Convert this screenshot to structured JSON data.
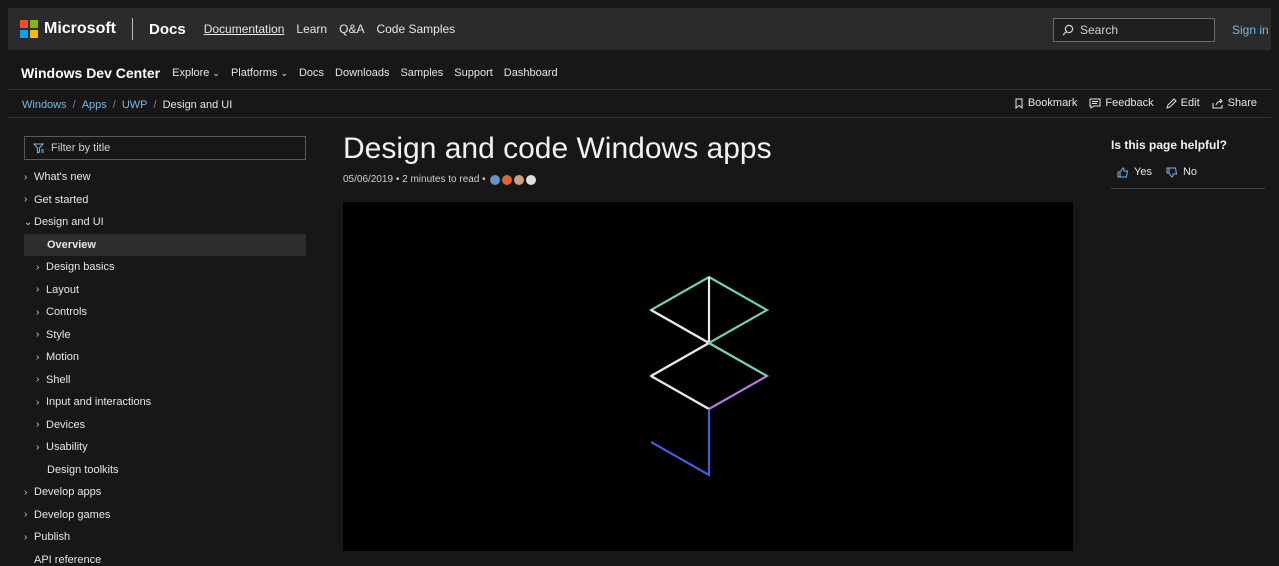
{
  "header": {
    "brand": "Microsoft",
    "brand_colors": [
      "#f25022",
      "#7fba00",
      "#00a4ef",
      "#ffb900"
    ],
    "docs": "Docs",
    "nav": [
      "Documentation",
      "Learn",
      "Q&A",
      "Code Samples"
    ],
    "search_placeholder": "Search",
    "sign_in": "Sign in"
  },
  "devcenter": {
    "title": "Windows Dev Center",
    "nav": [
      "Explore",
      "Platforms",
      "Docs",
      "Downloads",
      "Samples",
      "Support",
      "Dashboard"
    ]
  },
  "breadcrumb": {
    "items": [
      "Windows",
      "Apps",
      "UWP"
    ],
    "current": "Design and UI"
  },
  "actions": {
    "bookmark": "Bookmark",
    "feedback": "Feedback",
    "edit": "Edit",
    "share": "Share"
  },
  "sidebar": {
    "filter_placeholder": "Filter by title",
    "items": [
      {
        "label": "What's new",
        "arrow": ">"
      },
      {
        "label": "Get started",
        "arrow": ">"
      },
      {
        "label": "Design and UI",
        "arrow": "v"
      },
      {
        "label": "Overview"
      },
      {
        "label": "Design basics",
        "arrow": ">"
      },
      {
        "label": "Layout",
        "arrow": ">"
      },
      {
        "label": "Controls",
        "arrow": ">"
      },
      {
        "label": "Style",
        "arrow": ">"
      },
      {
        "label": "Motion",
        "arrow": ">"
      },
      {
        "label": "Shell",
        "arrow": ">"
      },
      {
        "label": "Input and interactions",
        "arrow": ">"
      },
      {
        "label": "Devices",
        "arrow": ">"
      },
      {
        "label": "Usability",
        "arrow": ">"
      },
      {
        "label": "Design toolkits"
      },
      {
        "label": "Develop apps",
        "arrow": ">"
      },
      {
        "label": "Develop games",
        "arrow": ">"
      },
      {
        "label": "Publish",
        "arrow": ">"
      },
      {
        "label": "API reference"
      }
    ]
  },
  "main": {
    "title": "Design and code Windows apps",
    "date": "05/06/2019",
    "read_time": "2 minutes to read",
    "contributor_colors": [
      "#6d8fc9",
      "#d9662e",
      "#c9a37a",
      "#e0e0e0"
    ]
  },
  "rail": {
    "question": "Is this page helpful?",
    "yes": "Yes",
    "no": "No"
  },
  "colors": {
    "link": "#75b6e7",
    "background": "#171717"
  }
}
